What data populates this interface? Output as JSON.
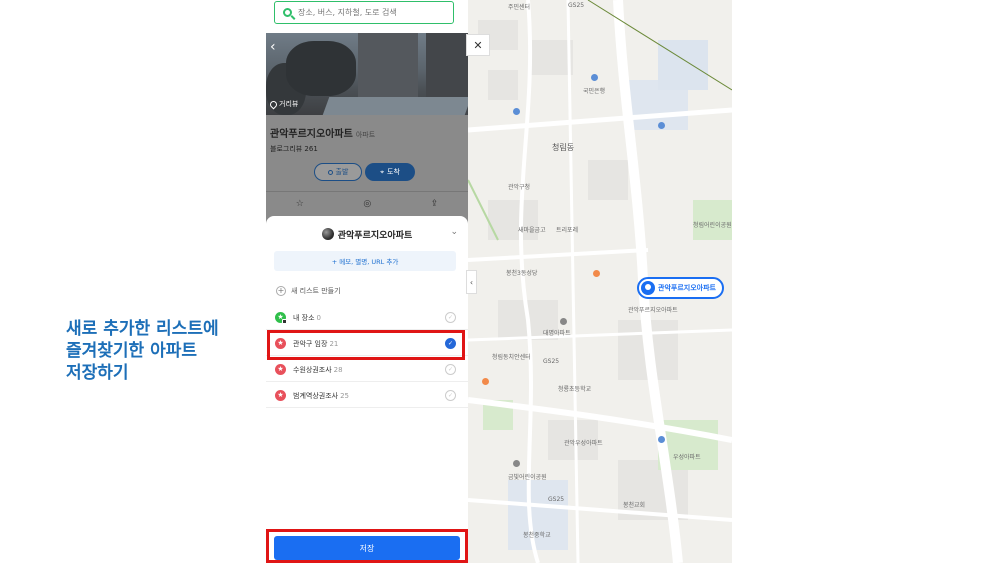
{
  "annotation": {
    "lines": [
      "새로 추가한 리스트에",
      "즐겨찾기한 아파트",
      "저장하기"
    ]
  },
  "search": {
    "placeholder": "장소, 버스, 지하철, 도로 검색"
  },
  "photo": {
    "streetview_label": "거리뷰"
  },
  "place": {
    "name": "관악푸르지오아파트",
    "category": "아파트",
    "review": "블로그리뷰 261",
    "depart_label": "출발",
    "arrive_label": "도착"
  },
  "sheet": {
    "title": "관악푸르지오아파트",
    "memo_label": "+ 메모, 별명, URL 추가",
    "new_list_label": "새 리스트 만들기",
    "lists": [
      {
        "name": "내 장소",
        "count": "0",
        "color": "#2fbf4a",
        "checked": false
      },
      {
        "name": "관악구 임장",
        "count": "21",
        "color": "#e8505b",
        "checked": true
      },
      {
        "name": "수원상권조사",
        "count": "28",
        "color": "#e8505b",
        "checked": false
      },
      {
        "name": "범계역상권조사",
        "count": "25",
        "color": "#e8505b",
        "checked": false
      }
    ],
    "save_label": "저장"
  },
  "map": {
    "pin_label": "관악푸르지오아파트",
    "labels": [
      "주민센터",
      "GS25",
      "국민은행",
      "청림동",
      "관악구청",
      "새마을금고",
      "트리포레",
      "청림어린이공원",
      "관악푸르지오아파트",
      "대명아파트",
      "청림동치안센터",
      "GS25",
      "관악우성아파트",
      "금빛어린이공원",
      "봉천3동성당",
      "청룡초등학교",
      "GS25",
      "봉천중학교",
      "우성아파트",
      "봉천교회"
    ]
  },
  "colors": {
    "accent": "#1a6ef2",
    "highlight": "#e01515",
    "annotation": "#1d6fb8"
  }
}
